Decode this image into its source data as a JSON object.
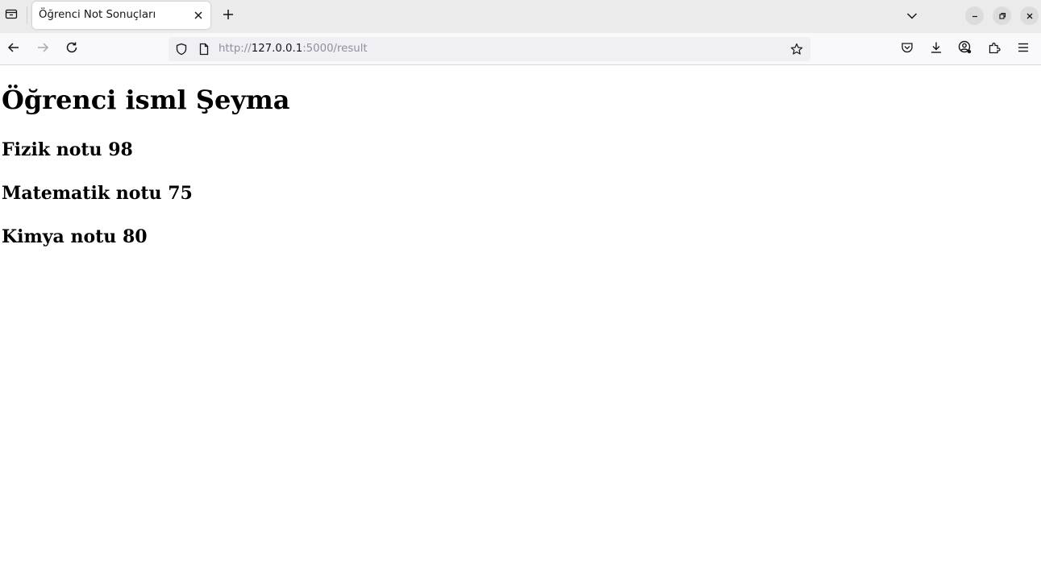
{
  "tab_strip": {
    "tab_title": "Öğrenci Not Sonuçları"
  },
  "navigation": {
    "url_scheme": "http://",
    "url_host": "127.0.0.1",
    "url_rest": ":5000/result"
  },
  "page": {
    "heading": "Öğrenci isml Şeyma",
    "grades": [
      "Fizik notu 98",
      "Matematik notu 75",
      "Kimya notu 80"
    ]
  },
  "icons": {
    "tab_list": "tab-list-icon",
    "tab_close": "close-icon",
    "new_tab": "plus-icon",
    "tab_overflow": "chevron-down-icon",
    "minimize": "minimize-icon",
    "restore": "restore-icon",
    "close_window": "close-icon",
    "back": "arrow-left-icon",
    "forward": "arrow-right-icon",
    "reload": "reload-icon",
    "tracking_protection": "shield-icon",
    "page_info": "page-icon",
    "bookmark": "star-icon",
    "pocket": "pocket-icon",
    "downloads": "download-icon",
    "account": "account-icon",
    "extensions": "puzzle-icon",
    "menu": "hamburger-menu-icon"
  },
  "colors": {
    "tab_strip_bg": "#ebebeb",
    "toolbar_bg": "#f9f9fb",
    "urlbar_bg": "#f0f0f4",
    "url_dim_text": "#8f8f9d",
    "text": "#15141a"
  }
}
